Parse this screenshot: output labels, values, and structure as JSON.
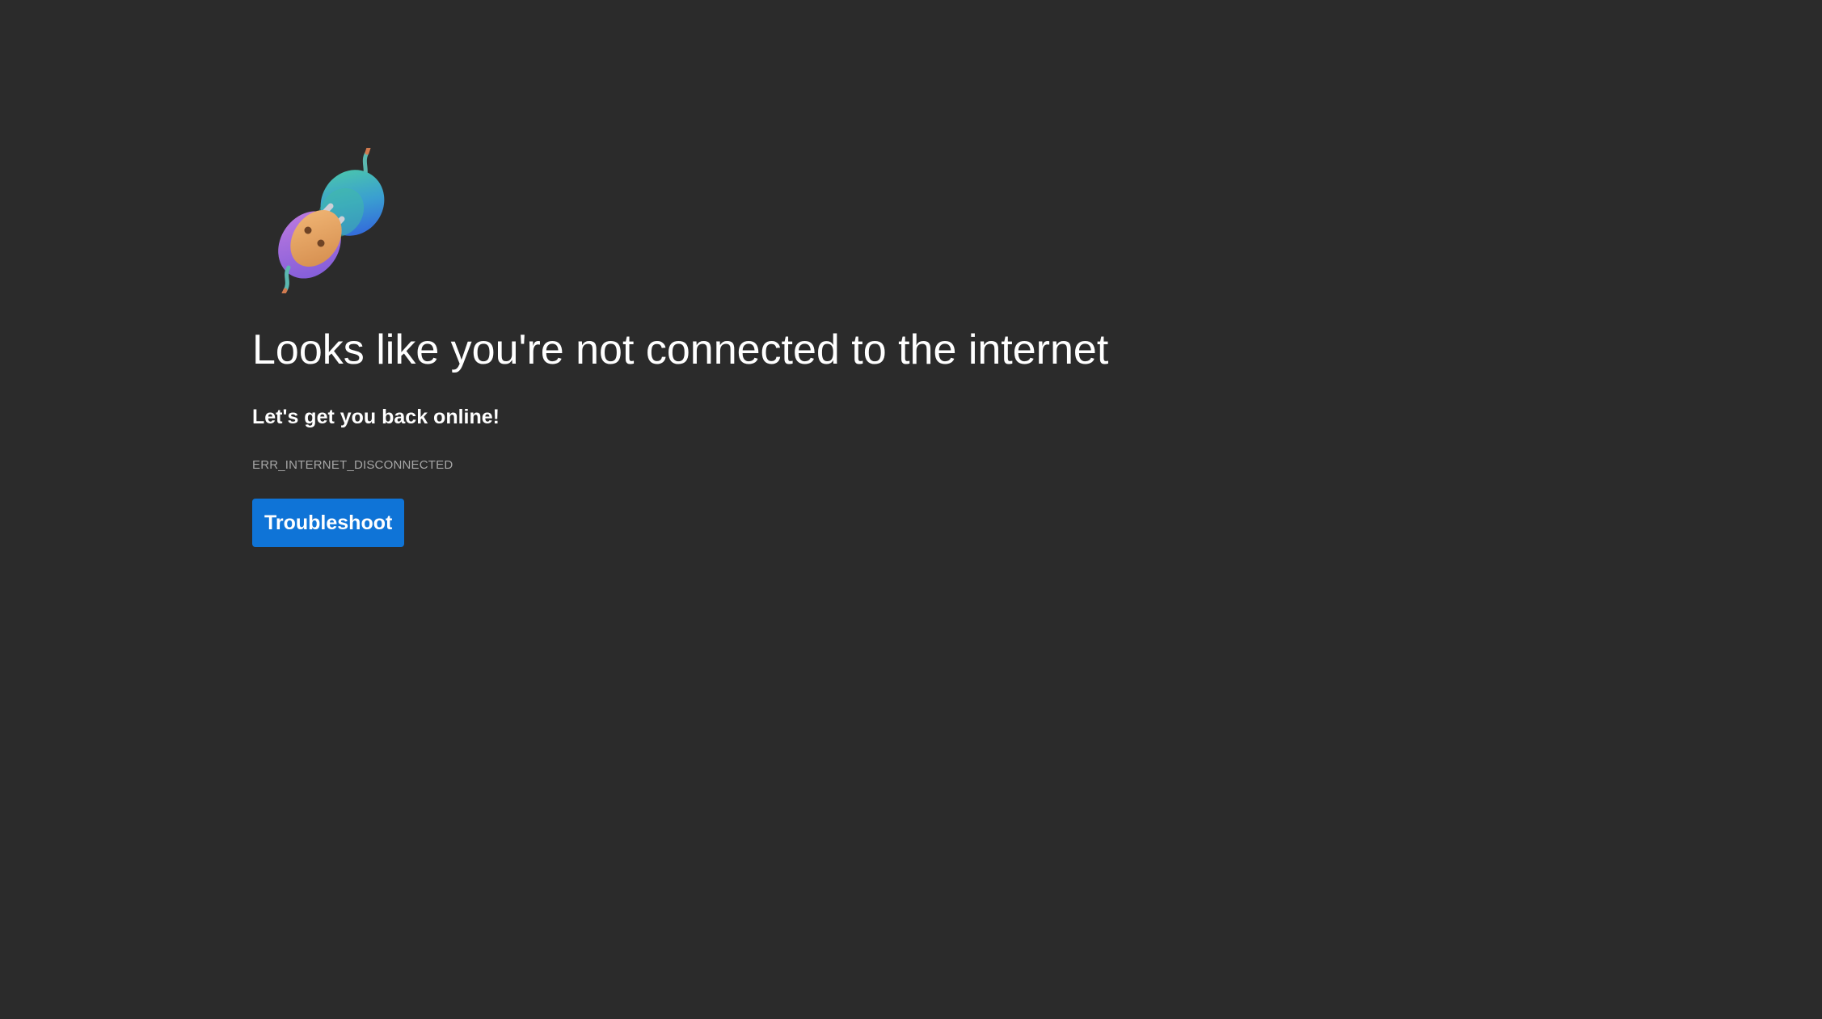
{
  "illustration": {
    "icon": "unplugged-plug-icon",
    "colors": {
      "socket": "#e8a35f",
      "socket_back": "#b76fd6",
      "plug_top": "#43c0ae",
      "plug_bottom": "#3368e3",
      "prong": "#cfcfd6"
    }
  },
  "error": {
    "title": "Looks like you're not connected to the internet",
    "subtitle": "Let's get you back online!",
    "code": "ERR_INTERNET_DISCONNECTED"
  },
  "actions": {
    "troubleshoot_label": "Troubleshoot"
  },
  "theme": {
    "background": "#2b2b2b",
    "text": "#ffffff",
    "muted_text": "#a6a6a6",
    "accent": "#0f74d7"
  }
}
